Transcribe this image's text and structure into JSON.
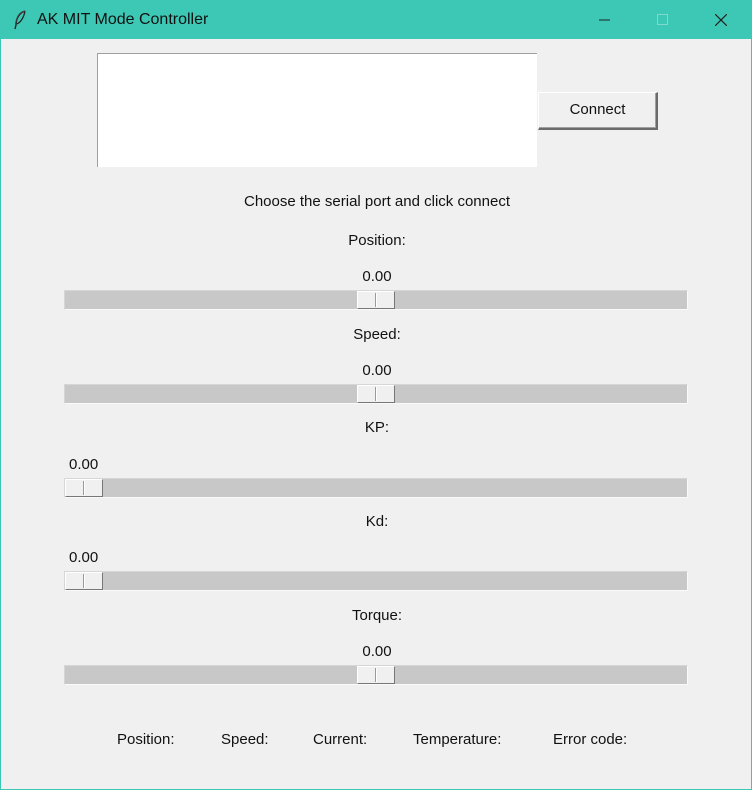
{
  "window": {
    "title": "AK MIT Mode Controller",
    "accent_color": "#3cc8b4",
    "icon": "feather-icon",
    "controls": [
      "minimize-icon",
      "maximize-icon",
      "close-icon"
    ]
  },
  "port_list": {
    "items": []
  },
  "connect_label": "Connect",
  "instruction": "Choose the serial port and click connect",
  "sliders": [
    {
      "label": "Position:",
      "value": "0.00",
      "level": 0.5
    },
    {
      "label": "Speed:",
      "value": "0.00",
      "level": 0.5
    },
    {
      "label": "KP:",
      "value": "0.00",
      "level": 0.0
    },
    {
      "label": "Kd:",
      "value": "0.00",
      "level": 0.0
    },
    {
      "label": "Torque:",
      "value": "0.00",
      "level": 0.5
    }
  ],
  "status": {
    "position_label": "Position:",
    "speed_label": "Speed:",
    "current_label": "Current:",
    "temperature_label": "Temperature:",
    "error_label": "Error code:"
  }
}
